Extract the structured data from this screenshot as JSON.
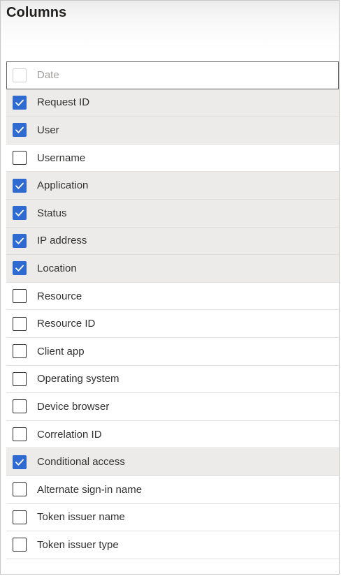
{
  "panel": {
    "title": "Columns"
  },
  "columns": [
    {
      "label": "Date",
      "checked": false,
      "disabled": true
    },
    {
      "label": "Request ID",
      "checked": true,
      "disabled": false
    },
    {
      "label": "User",
      "checked": true,
      "disabled": false
    },
    {
      "label": "Username",
      "checked": false,
      "disabled": false
    },
    {
      "label": "Application",
      "checked": true,
      "disabled": false
    },
    {
      "label": "Status",
      "checked": true,
      "disabled": false
    },
    {
      "label": "IP address",
      "checked": true,
      "disabled": false
    },
    {
      "label": "Location",
      "checked": true,
      "disabled": false
    },
    {
      "label": "Resource",
      "checked": false,
      "disabled": false
    },
    {
      "label": "Resource ID",
      "checked": false,
      "disabled": false
    },
    {
      "label": "Client app",
      "checked": false,
      "disabled": false
    },
    {
      "label": "Operating system",
      "checked": false,
      "disabled": false
    },
    {
      "label": "Device browser",
      "checked": false,
      "disabled": false
    },
    {
      "label": "Correlation ID",
      "checked": false,
      "disabled": false
    },
    {
      "label": "Conditional access",
      "checked": true,
      "disabled": false
    },
    {
      "label": "Alternate sign-in name",
      "checked": false,
      "disabled": false
    },
    {
      "label": "Token issuer name",
      "checked": false,
      "disabled": false
    },
    {
      "label": "Token issuer type",
      "checked": false,
      "disabled": false
    }
  ],
  "colors": {
    "checked_box": "#2f6ad0",
    "checked_row": "#edebe9",
    "disabled_text": "#a19f9d"
  },
  "icons": {
    "checked": "checkmark-icon"
  }
}
